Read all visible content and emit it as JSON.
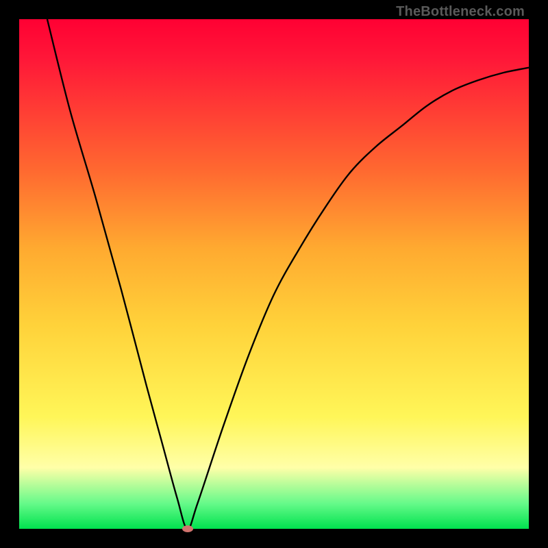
{
  "watermark": "TheBottleneck.com",
  "chart_data": {
    "type": "line",
    "title": "",
    "xlabel": "",
    "ylabel": "",
    "xlim": [
      0,
      1
    ],
    "ylim": [
      0,
      1
    ],
    "series": [
      {
        "name": "curve",
        "x": [
          0.055,
          0.1,
          0.15,
          0.2,
          0.25,
          0.28,
          0.31,
          0.33,
          0.35,
          0.4,
          0.45,
          0.5,
          0.55,
          0.6,
          0.65,
          0.7,
          0.75,
          0.8,
          0.85,
          0.9,
          0.95,
          1.0
        ],
        "values": [
          1.0,
          0.82,
          0.65,
          0.47,
          0.28,
          0.17,
          0.06,
          0.0,
          0.05,
          0.2,
          0.34,
          0.46,
          0.55,
          0.63,
          0.7,
          0.75,
          0.79,
          0.83,
          0.86,
          0.88,
          0.895,
          0.905
        ]
      }
    ],
    "marker": {
      "x": 0.33,
      "y": 0.0,
      "color": "#d2736e"
    }
  }
}
